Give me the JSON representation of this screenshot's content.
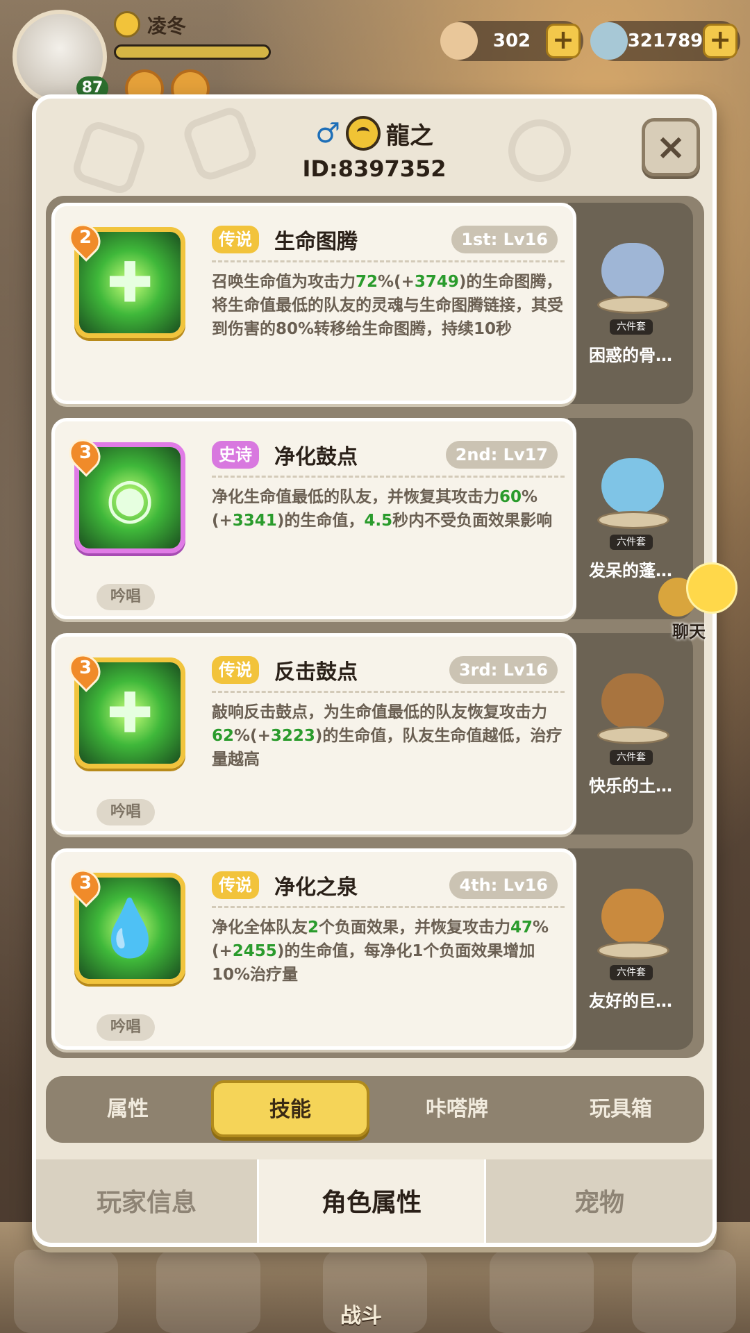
{
  "player": {
    "name": "凌冬",
    "level": "87",
    "exp_fraction": 1.0
  },
  "currency": {
    "shells": "302",
    "gems": "321789",
    "plus": "+"
  },
  "bottom_nav": {
    "battle_label": "战斗"
  },
  "dialog": {
    "character_name": "龍之",
    "character_id": "ID:8397352",
    "gender_symbol": "♂",
    "close_symbol": "×"
  },
  "skills": [
    {
      "badge_level": "2",
      "rarity": "传说",
      "rarity_color": "#f2c33b",
      "name": "生命图腾",
      "slot_level": "1st: Lv16",
      "desc_parts": [
        "召唤生命值为攻击力",
        "72",
        "%(+",
        "3749",
        ")的生命图腾，将生命值最低的队友的灵魂与生命图腾链接，其受到伤害的80%转移给生命图腾，持续10秒"
      ],
      "chant": "",
      "icon": "totem-icon",
      "side_name": "困惑的骨…",
      "side_tag": "六件套"
    },
    {
      "badge_level": "3",
      "rarity": "史诗",
      "rarity_color": "#d878df",
      "name": "净化鼓点",
      "slot_level": "2nd: Lv17",
      "desc_parts": [
        "净化生命值最低的队友，并恢复其攻击力",
        "60",
        "%(+",
        "3341",
        ")的生命值，",
        "4.5",
        "秒内不受负面效果影响"
      ],
      "chant": "吟唱",
      "icon": "drum-icon",
      "side_name": "发呆的蓬…",
      "side_tag": "六件套"
    },
    {
      "badge_level": "3",
      "rarity": "传说",
      "rarity_color": "#f2c33b",
      "name": "反击鼓点",
      "slot_level": "3rd: Lv16",
      "desc_parts": [
        "敲响反击鼓点，为生命值最低的队友恢复攻击力",
        "62",
        "%(+",
        "3223",
        ")的生命值，队友生命值越低，治疗量越高"
      ],
      "chant": "吟唱",
      "icon": "counter-drum-icon",
      "side_name": "快乐的土…",
      "side_tag": "六件套"
    },
    {
      "badge_level": "3",
      "rarity": "传说",
      "rarity_color": "#f2c33b",
      "name": "净化之泉",
      "slot_level": "4th: Lv16",
      "desc_parts": [
        "净化全体队友",
        "2",
        "个负面效果，并恢复攻击力",
        "47",
        "%(+",
        "2455",
        ")的生命值，每净化1个负面效果增加10%治疗量"
      ],
      "chant": "吟唱",
      "icon": "spring-drop-icon",
      "side_name": "友好的巨…",
      "side_tag": "六件套"
    }
  ],
  "chat": {
    "label": "聊天"
  },
  "subtabs": [
    {
      "label": "属性",
      "active": false
    },
    {
      "label": "技能",
      "active": true
    },
    {
      "label": "咔嗒牌",
      "active": false
    },
    {
      "label": "玩具箱",
      "active": false
    }
  ],
  "maintabs": [
    {
      "label": "玩家信息",
      "active": false
    },
    {
      "label": "角色属性",
      "active": true
    },
    {
      "label": "宠物",
      "active": false
    }
  ]
}
